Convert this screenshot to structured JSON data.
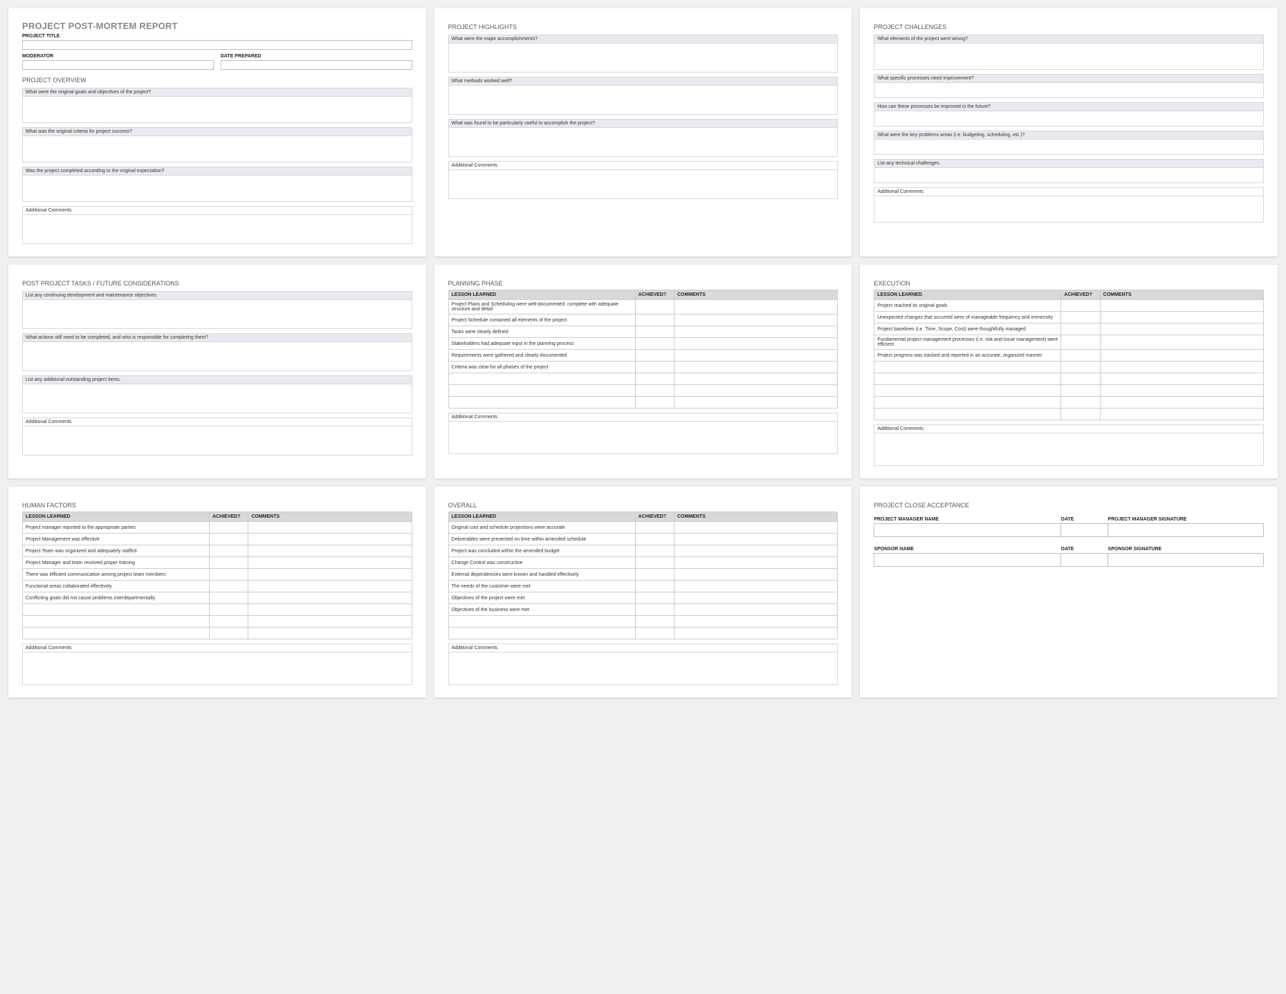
{
  "card1": {
    "title": "PROJECT POST-MORTEM REPORT",
    "projectTitleLabel": "PROJECT TITLE",
    "moderatorLabel": "MODERATOR",
    "datePreparedLabel": "DATE PREPARED",
    "overviewTitle": "PROJECT OVERVIEW",
    "q1": "What were the original goals and objectives of the project?",
    "q2": "What was the original criteria for project success?",
    "q3": "Was the project completed according to the original expectation?",
    "addl": "Additional Comments"
  },
  "card2": {
    "title": "PROJECT HIGHLIGHTS",
    "q1": "What were the major accomplishments?",
    "q2": "What methods worked well?",
    "q3": "What was found to be particularly useful to accomplish the project?",
    "addl": "Additional Comments"
  },
  "card3": {
    "title": "PROJECT CHALLENGES",
    "q1": "What elements of the project went wrong?",
    "q2": "What specific processes need improvement?",
    "q3": "How can these processes be improved in the future?",
    "q4": "What were the key problems areas (i.e. budgeting, scheduling, etc.)?",
    "q5": "List any technical challenges.",
    "addl": "Additional Comments"
  },
  "card4": {
    "title": "POST PROJECT TASKS / FUTURE CONSIDERATIONS",
    "q1": "List any continuing development and maintenance objectives.",
    "q2": "What actions still need to be completed, and who is responsible for completing them?",
    "q3": "List any additional outstanding project items.",
    "addl": "Additional Comments"
  },
  "tableHeaders": {
    "lesson": "LESSON LEARNED",
    "achieved": "ACHIEVED?",
    "comments": "COMMENTS"
  },
  "card5": {
    "title": "PLANNING PHASE",
    "rows": [
      "Project Plans and Scheduling were well-documented, complete with adequate structure and detail",
      "Project Schedule contained all elements of the project",
      "Tasks were clearly defined",
      "Stakeholders had adequate input in the planning process",
      "Requirements were gathered and clearly documented",
      "Criteria was clear for all phases of the project",
      "",
      "",
      ""
    ],
    "addl": "Additional Comments"
  },
  "card6": {
    "title": "EXECUTION",
    "rows": [
      "Project reached its original goals",
      "Unexpected changes that occurred were of manageable frequency and immensity",
      "Project baselines (i.e. Time, Scope, Cost) were thoughtfully managed",
      "Fundamental project management processes (i.e. risk and issue management) were efficient",
      "Project progress was tracked and reported in an accurate, organized manner",
      "",
      "",
      "",
      "",
      ""
    ],
    "addl": "Additional Comments"
  },
  "card7": {
    "title": "HUMAN FACTORS",
    "rows": [
      "Project manager reported to the appropriate parties",
      "Project Management was effective",
      "Project Team was organized and adequately staffed",
      "Project Manager and team received proper training",
      "There was efficient communication among project team members",
      "Functional areas collaborated effectively",
      "Conflicting goals did not cause problems interdepartmentally",
      "",
      "",
      ""
    ],
    "addl": "Additional Comments"
  },
  "card8": {
    "title": "OVERALL",
    "rows": [
      "Original cost and schedule projections were accurate",
      "Deliverables were presented on time within amended schedule",
      "Project was concluded within the amended budget",
      "Change Control was constructive",
      "External dependencies were known and handled effectively",
      "The needs of the customer were met",
      "Objectives of the project were met",
      "Objectives of the business were met",
      "",
      ""
    ],
    "addl": "Additional Comments"
  },
  "card9": {
    "title": "PROJECT CLOSE ACCEPTANCE",
    "pmName": "PROJECT MANAGER NAME",
    "date": "DATE",
    "pmSig": "PROJECT MANAGER SIGNATURE",
    "sponsorName": "SPONSOR NAME",
    "sponsorSig": "SPONSOR SIGNATURE"
  }
}
